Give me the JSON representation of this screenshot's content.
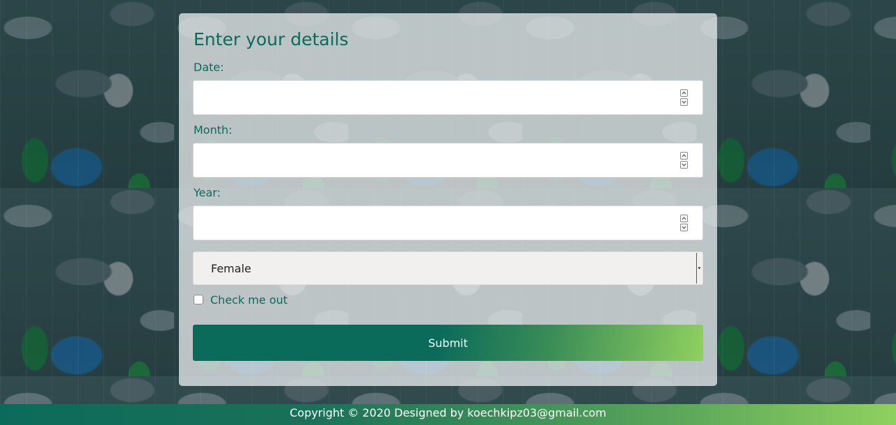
{
  "form": {
    "title": "Enter your details",
    "date_label": "Date:",
    "month_label": "Month:",
    "year_label": "Year:",
    "date_value": "",
    "month_value": "",
    "year_value": "",
    "gender_select": {
      "selected": "Female"
    },
    "checkbox": {
      "label": "Check me out",
      "checked": false
    },
    "submit_label": "Submit"
  },
  "footer": {
    "text": "Copyright © 2020 Designed by koechkipz03@gmail.com"
  },
  "colors": {
    "accent": "#0b6b5a",
    "gradient_end": "#8fd15f",
    "card_bg": "#e6e9eb"
  },
  "background": {
    "icon": "rainy-garden-background"
  }
}
